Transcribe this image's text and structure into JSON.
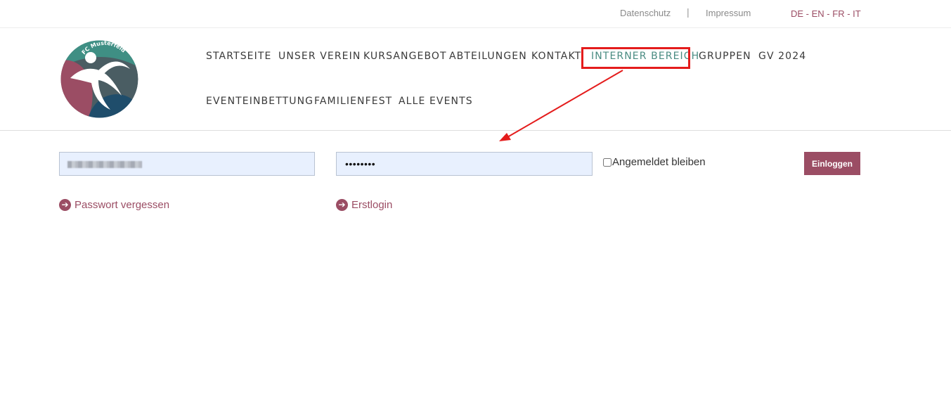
{
  "topbar": {
    "links": [
      "Datenschutz",
      "Impressum"
    ],
    "separator": "|",
    "languages": [
      "DE",
      "EN",
      "FR",
      "IT"
    ],
    "lang_separator": " - "
  },
  "logo": {
    "text": "FC Musterfeld",
    "colors": {
      "teal": "#3f8f84",
      "wine": "#9b4d64",
      "navy": "#1f4d6b",
      "slate": "#4a5d63"
    }
  },
  "nav": {
    "items": [
      "STARTSEITE",
      "UNSER VEREIN",
      "KURSANGEBOT",
      "ABTEILUNGEN",
      "KONTAKT",
      "INTERNER BEREICH",
      "GRUPPEN",
      "GV 2024",
      "EVENTEINBETTUNG",
      "FAMILIENFEST",
      "ALLE EVENTS"
    ],
    "active": "INTERNER BEREICH"
  },
  "login": {
    "username_value": "",
    "password_mask": "••••••••",
    "remember_label": "Angemeldet bleiben",
    "submit_label": "Einloggen",
    "forgot_label": "Passwort vergessen",
    "firstlogin_label": "Erstlogin"
  },
  "colors": {
    "accent": "#9b4d64",
    "active_nav": "#4a8c82",
    "annotation": "#e41c1c",
    "input_bg": "#e8f0fe"
  },
  "icons": [
    "arrow-circle-right-icon",
    "arrow-circle-right-icon"
  ]
}
